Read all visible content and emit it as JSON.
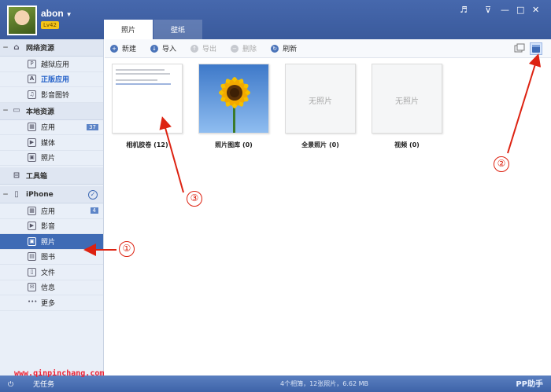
{
  "user": {
    "name": "abon",
    "level": "Lv42"
  },
  "tabs": [
    "照片",
    "壁纸"
  ],
  "window_controls": [
    "♬",
    "⊽",
    "—",
    "□",
    "✕"
  ],
  "sidebar": {
    "network": {
      "title": "网络资源",
      "items": [
        {
          "label": "越狱应用",
          "icon": "P"
        },
        {
          "label": "正版应用",
          "icon": "A"
        },
        {
          "label": "影音图铃",
          "icon": "♫"
        }
      ]
    },
    "local": {
      "title": "本地资源",
      "items": [
        {
          "label": "应用",
          "badge": "37"
        },
        {
          "label": "媒体"
        },
        {
          "label": "照片"
        }
      ]
    },
    "toolbox": {
      "title": "工具箱"
    },
    "iphone": {
      "title": "iPhone",
      "items": [
        {
          "label": "应用",
          "badge": "4"
        },
        {
          "label": "影音"
        },
        {
          "label": "照片"
        },
        {
          "label": "图书"
        },
        {
          "label": "文件"
        },
        {
          "label": "信息"
        },
        {
          "label": "更多"
        }
      ]
    }
  },
  "toolbar": {
    "new": "新建",
    "import": "导入",
    "export": "导出",
    "delete": "删除",
    "refresh": "刷新"
  },
  "albums": [
    {
      "label": "相机胶卷 (12)"
    },
    {
      "label": "照片图库 (0)"
    },
    {
      "label": "全景照片 (0)",
      "placeholder": "无照片"
    },
    {
      "label": "视频 (0)",
      "placeholder": "无照片"
    }
  ],
  "status": {
    "tasks": "无任务",
    "summary": "4个相簿，12张照片，6.62 MB",
    "brand": "PP助手"
  },
  "watermark": "www.qinpinchang.com",
  "annotations": [
    "①",
    "②",
    "③"
  ],
  "colors": {
    "accent": "#3f6bb5",
    "annotation": "#dd2222"
  }
}
